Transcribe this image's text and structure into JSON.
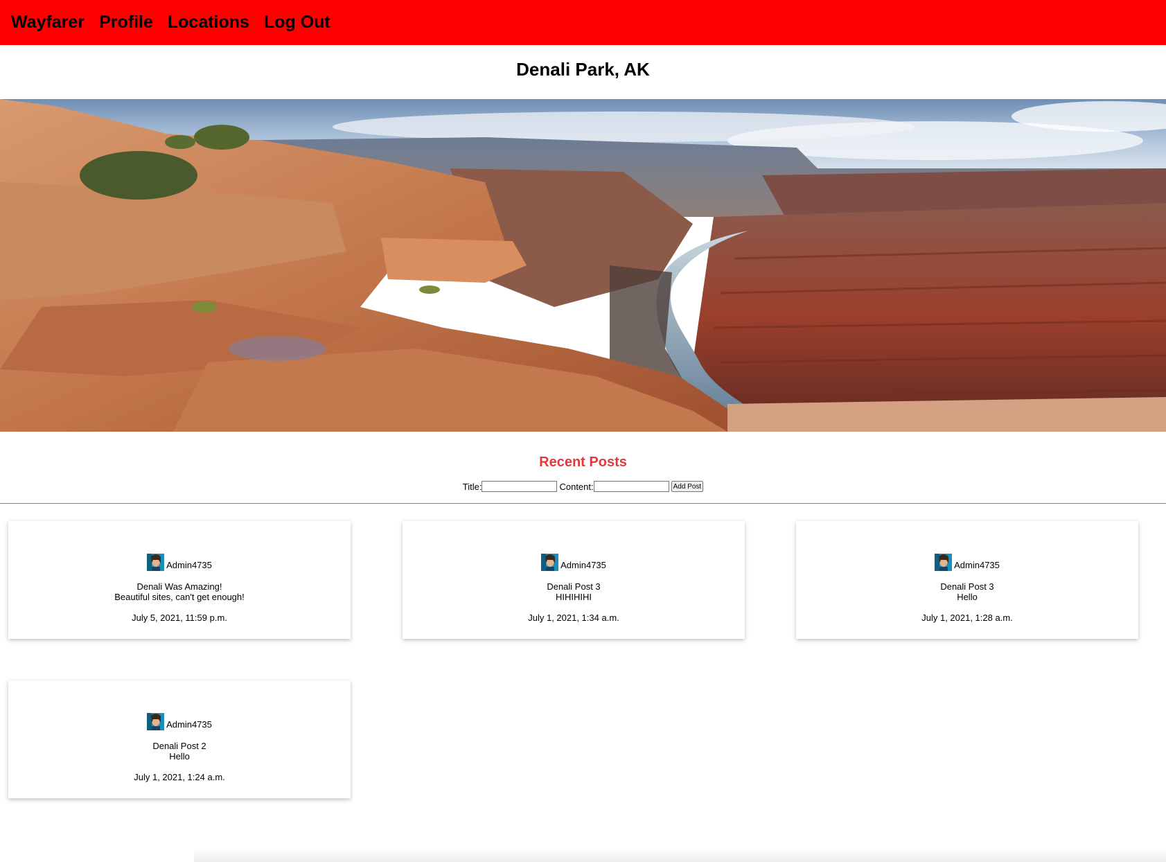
{
  "nav": {
    "items": [
      "Wayfarer",
      "Profile",
      "Locations",
      "Log Out"
    ],
    "background": "#ff0000"
  },
  "location": {
    "title": "Denali Park, AK",
    "hero_image": "canyon-landscape-photo"
  },
  "recent_posts": {
    "heading": "Recent Posts",
    "heading_color": "#e0393e",
    "form": {
      "title_label": "Title:",
      "title_value": "",
      "content_label": "Content:",
      "content_value": "",
      "submit_label": "Add Post"
    },
    "posts": [
      {
        "author": "Admin4735",
        "avatar_icon": "user-avatar-icon",
        "title": "Denali Was Amazing!",
        "content": "Beautiful sites, can't get enough!",
        "date": "July 5, 2021, 11:59 p.m."
      },
      {
        "author": "Admin4735",
        "avatar_icon": "user-avatar-icon",
        "title": "Denali Post 3",
        "content": "HIHIHIHI",
        "date": "July 1, 2021, 1:34 a.m."
      },
      {
        "author": "Admin4735",
        "avatar_icon": "user-avatar-icon",
        "title": "Denali Post 3",
        "content": "Hello",
        "date": "July 1, 2021, 1:28 a.m."
      },
      {
        "author": "Admin4735",
        "avatar_icon": "user-avatar-icon",
        "title": "Denali Post 2",
        "content": "Hello",
        "date": "July 1, 2021, 1:24 a.m."
      }
    ]
  }
}
